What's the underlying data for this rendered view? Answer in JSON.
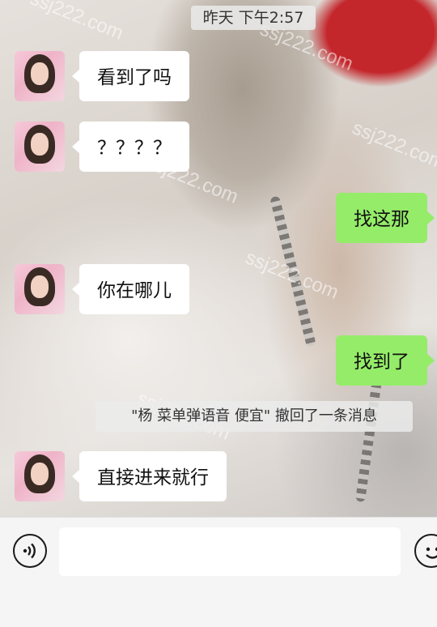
{
  "header": {
    "timestamp": "昨天 下午2:57"
  },
  "watermark_text": "ssj222.com",
  "messages": [
    {
      "side": "in",
      "text": "看到了吗"
    },
    {
      "side": "in",
      "text": "？？？？"
    },
    {
      "side": "out",
      "text": "找这那"
    },
    {
      "side": "in",
      "text": "你在哪儿"
    },
    {
      "side": "out",
      "text": "找到了"
    },
    {
      "side": "in",
      "text": "直接进来就行"
    }
  ],
  "system_notice": "\"杨 菜单弹语音 便宜\" 撤回了一条消息",
  "input_bar": {
    "voice_icon": "voice-icon",
    "emoji_icon": "emoji-icon",
    "text_value": ""
  },
  "colors": {
    "outgoing_bubble": "#95ec69",
    "incoming_bubble": "#ffffff",
    "input_bar_bg": "#f5f5f5"
  }
}
